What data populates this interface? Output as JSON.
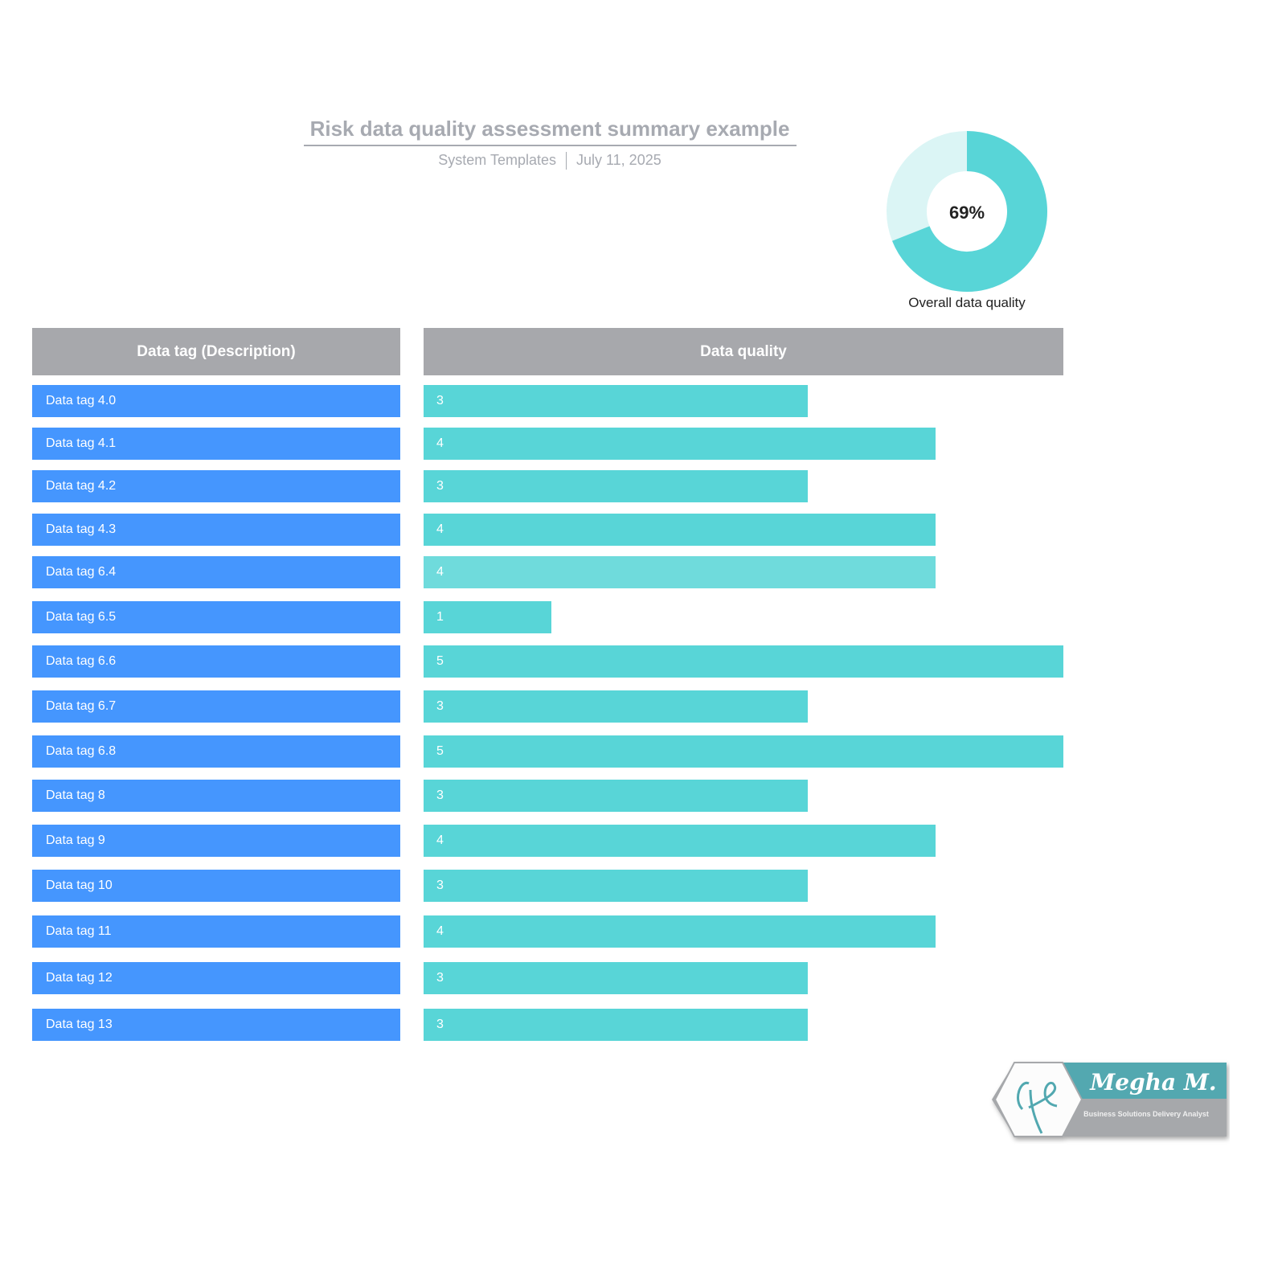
{
  "header": {
    "title": "Risk data quality assessment summary example",
    "source": "System Templates",
    "date": "July 11, 2025"
  },
  "donut": {
    "value_percent": 69,
    "label": "69%",
    "caption": "Overall data quality",
    "colors": {
      "filled": "#58d5d7",
      "remaining": "#dbf5f5"
    }
  },
  "table": {
    "col1_header": "Data tag (Description)",
    "col2_header": "Data quality"
  },
  "colors": {
    "tag": "#4596fe",
    "bar": "#58d5d7",
    "bar_highlight": "#6fdbdc",
    "header": "#a7a8ac"
  },
  "chart_data": {
    "type": "bar",
    "orientation": "horizontal",
    "categories": [
      "Data tag 4.0",
      "Data tag 4.1",
      "Data tag 4.2",
      "Data tag 4.3",
      "Data tag 6.4",
      "Data tag 6.5",
      "Data tag 6.6",
      "Data tag 6.7",
      "Data tag 6.8",
      "Data tag 8",
      "Data tag 9",
      "Data tag 10",
      "Data tag 11",
      "Data tag 12",
      "Data tag 13"
    ],
    "values": [
      3,
      4,
      3,
      4,
      4,
      1,
      5,
      3,
      5,
      3,
      4,
      3,
      4,
      3,
      3
    ],
    "xlim": [
      0,
      5
    ],
    "highlighted_category": "Data tag 6.4"
  },
  "logo": {
    "name": "Megha M.",
    "tagline": "Business Solutions Delivery Analyst"
  }
}
